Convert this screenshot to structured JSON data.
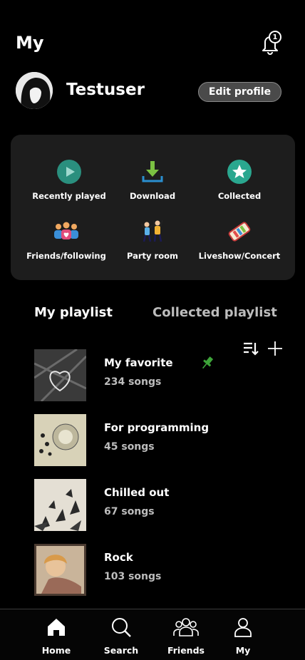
{
  "header": {
    "title": "My",
    "notification_count": "1"
  },
  "profile": {
    "username": "Testuser",
    "edit_label": "Edit profile"
  },
  "quick_actions": [
    {
      "label": "Recently played",
      "icon": "play-circle-icon"
    },
    {
      "label": "Download",
      "icon": "download-icon"
    },
    {
      "label": "Collected",
      "icon": "star-circle-icon"
    },
    {
      "label": "Friends/following",
      "icon": "friends-icon"
    },
    {
      "label": "Party room",
      "icon": "party-icon"
    },
    {
      "label": "Liveshow/Concert",
      "icon": "concert-icon"
    }
  ],
  "tabs": {
    "active": "My playlist",
    "inactive": "Collected playlist"
  },
  "playlists": [
    {
      "name": "My favorite",
      "count": "234 songs",
      "pinned": true
    },
    {
      "name": "For programming",
      "count": "45 songs",
      "pinned": false
    },
    {
      "name": "Chilled out",
      "count": "67 songs",
      "pinned": false
    },
    {
      "name": "Rock",
      "count": "103 songs",
      "pinned": false
    }
  ],
  "nav": [
    {
      "label": "Home",
      "icon": "home-icon",
      "active": true
    },
    {
      "label": "Search",
      "icon": "search-icon",
      "active": false
    },
    {
      "label": "Friends",
      "icon": "friends-nav-icon",
      "active": false
    },
    {
      "label": "My",
      "icon": "user-icon",
      "active": false
    }
  ],
  "colors": {
    "background": "#000000",
    "panel": "#1d1d1d",
    "accent_teal": "#2aa78f",
    "pin_green": "#3ea53a"
  }
}
